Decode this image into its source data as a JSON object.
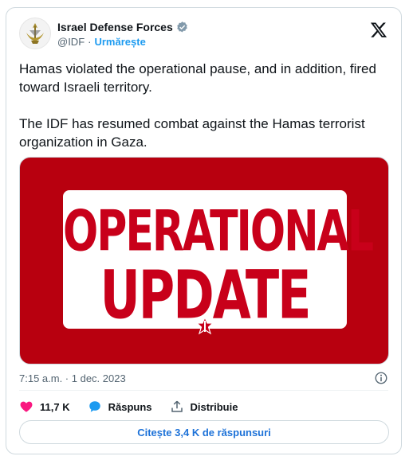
{
  "tweet": {
    "author": {
      "display_name": "Israel Defense Forces",
      "handle": "@IDF",
      "separator": "·",
      "follow_label": "Urmărește",
      "verified_icon": "verified-badge-icon",
      "avatar_icon": "idf-emblem"
    },
    "platform_icon": "x-logo-icon",
    "text": {
      "paragraph_1": "Hamas violated the operational pause, and in addition, fired toward Israeli territory.",
      "paragraph_2": "The IDF has resumed combat against the Hamas terrorist organization in Gaza."
    },
    "media": {
      "line_1": "OPERATIONAL",
      "line_2": "UPDATE",
      "background_color": "#b8000f",
      "text_color": "#c8001a"
    },
    "timestamp": "7:15 a.m. · 1 dec. 2023",
    "actions": {
      "likes_count": "11,7 K",
      "reply_label": "Răspuns",
      "share_label": "Distribuie"
    },
    "read_replies_label": "Citește 3,4 K de răspunsuri"
  },
  "colors": {
    "accent": "#1d9bf0",
    "like": "#f91880",
    "text": "#0f1419",
    "muted": "#536471"
  }
}
